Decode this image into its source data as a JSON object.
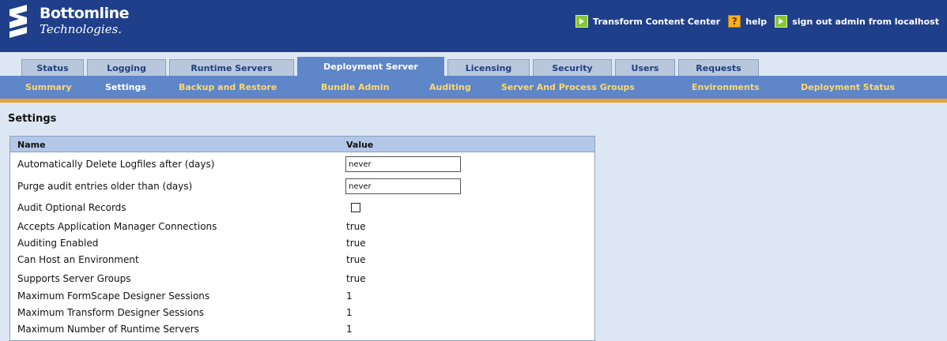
{
  "brand": {
    "name": "Bottomline",
    "subtitle": "Technologies."
  },
  "top_links": [
    {
      "label": "Transform Content Center",
      "icon": "arrow-icon"
    },
    {
      "label": "help",
      "icon": "help-icon"
    },
    {
      "label": "sign out admin from localhost",
      "icon": "arrow-icon"
    }
  ],
  "tabs": [
    {
      "label": "Status"
    },
    {
      "label": "Logging"
    },
    {
      "label": "Runtime Servers"
    },
    {
      "label": "Deployment Server",
      "active": true
    },
    {
      "label": "Licensing"
    },
    {
      "label": "Security"
    },
    {
      "label": "Users"
    },
    {
      "label": "Requests"
    }
  ],
  "subnav": [
    {
      "label": "Summary"
    },
    {
      "label": "Settings",
      "active": true
    },
    {
      "label": "Backup and Restore"
    },
    {
      "label": "Bundle Admin"
    },
    {
      "label": "Auditing"
    },
    {
      "label": "Server And Process Groups"
    },
    {
      "label": "Environments"
    },
    {
      "label": "Deployment Status"
    }
  ],
  "page": {
    "title": "Settings",
    "columns": {
      "name": "Name",
      "value": "Value"
    },
    "rows": [
      {
        "name": "Automatically Delete Logfiles after (days)",
        "type": "input",
        "value": "never"
      },
      {
        "name": "Purge audit entries older than (days)",
        "type": "input",
        "value": "never"
      },
      {
        "name": "Audit Optional Records",
        "type": "checkbox",
        "checked": false
      },
      {
        "name": "Accepts Application Manager Connections",
        "type": "text",
        "value": "true"
      },
      {
        "name": "Auditing Enabled",
        "type": "text",
        "value": "true"
      },
      {
        "name": "Can Host an Environment",
        "type": "text",
        "value": "true"
      },
      {
        "name": "Supports Server Groups",
        "type": "text",
        "value": "true"
      },
      {
        "name": "Maximum FormScape Designer Sessions",
        "type": "text",
        "value": "1"
      },
      {
        "name": "Maximum Transform Designer Sessions",
        "type": "text",
        "value": "1"
      },
      {
        "name": "Maximum Number of Runtime Servers",
        "type": "text",
        "value": "1"
      }
    ]
  },
  "colors": {
    "header": "#1f3f8b",
    "subnav": "#5f86c9",
    "accent_bar": "#e8a33a",
    "sublink": "#ffd86b"
  }
}
